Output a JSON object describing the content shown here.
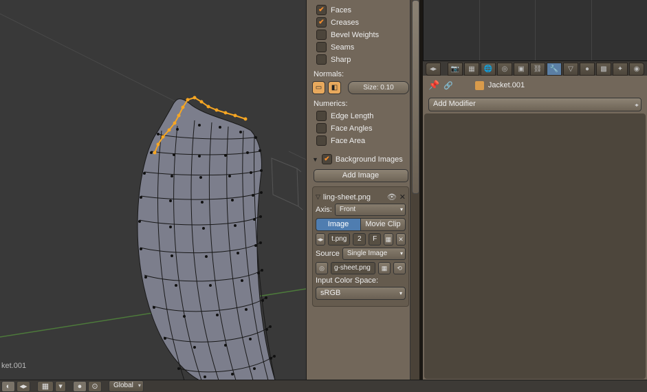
{
  "viewport": {
    "object_label": "ket.001"
  },
  "header": {
    "shading": "Global"
  },
  "overlays": {
    "faces": "Faces",
    "creases": "Creases",
    "bevel_weights": "Bevel Weights",
    "seams": "Seams",
    "sharp": "Sharp"
  },
  "normals": {
    "label": "Normals:",
    "size": "Size: 0.10"
  },
  "numerics": {
    "label": "Numerics:",
    "edge_length": "Edge Length",
    "face_angles": "Face Angles",
    "face_area": "Face Area"
  },
  "bg_images": {
    "title": "Background Images",
    "add": "Add Image",
    "file": "ling-sheet.png",
    "axis_label": "Axis:",
    "axis_value": "Front",
    "image_tab": "Image",
    "movie_tab": "Movie Clip",
    "tex_file": "t.png",
    "num": "2",
    "f": "F",
    "source_label": "Source",
    "source_value": "Single Image",
    "packed_file": "g-sheet.png",
    "colorspace_label": "Input Color Space:",
    "colorspace_value": "sRGB"
  },
  "props": {
    "object": "Jacket.001",
    "add_modifier": "Add Modifier"
  }
}
